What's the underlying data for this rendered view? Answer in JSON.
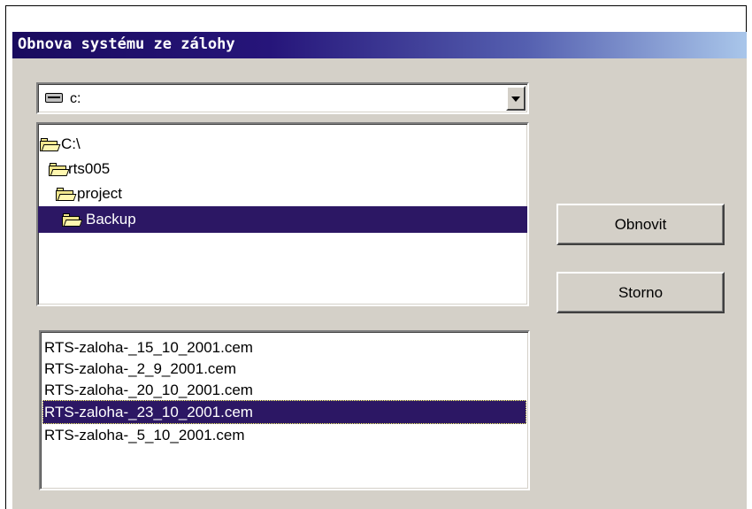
{
  "dialog": {
    "title": "Obnova systému ze zálohy"
  },
  "drive_select": {
    "value": "c:",
    "icon": "drive-icon"
  },
  "folder_tree": {
    "items": [
      {
        "label": "C:\\",
        "selected": false
      },
      {
        "label": "rts005",
        "selected": false
      },
      {
        "label": "project",
        "selected": false
      },
      {
        "label": "Backup",
        "selected": true
      }
    ]
  },
  "file_list": {
    "items": [
      {
        "label": "RTS-zaloha-_15_10_2001.cem",
        "selected": false
      },
      {
        "label": "RTS-zaloha-_2_9_2001.cem",
        "selected": false
      },
      {
        "label": "RTS-zaloha-_20_10_2001.cem",
        "selected": false
      },
      {
        "label": "RTS-zaloha-_23_10_2001.cem",
        "selected": true
      },
      {
        "label": "RTS-zaloha-_5_10_2001.cem",
        "selected": false
      }
    ]
  },
  "buttons": {
    "restore_label": "Obnovit",
    "cancel_label": "Storno"
  },
  "colors": {
    "title_start": "#1a0b5e",
    "title_end": "#a9c6ea",
    "selection": "#2c1764",
    "dialog_face": "#d4d0c8"
  }
}
